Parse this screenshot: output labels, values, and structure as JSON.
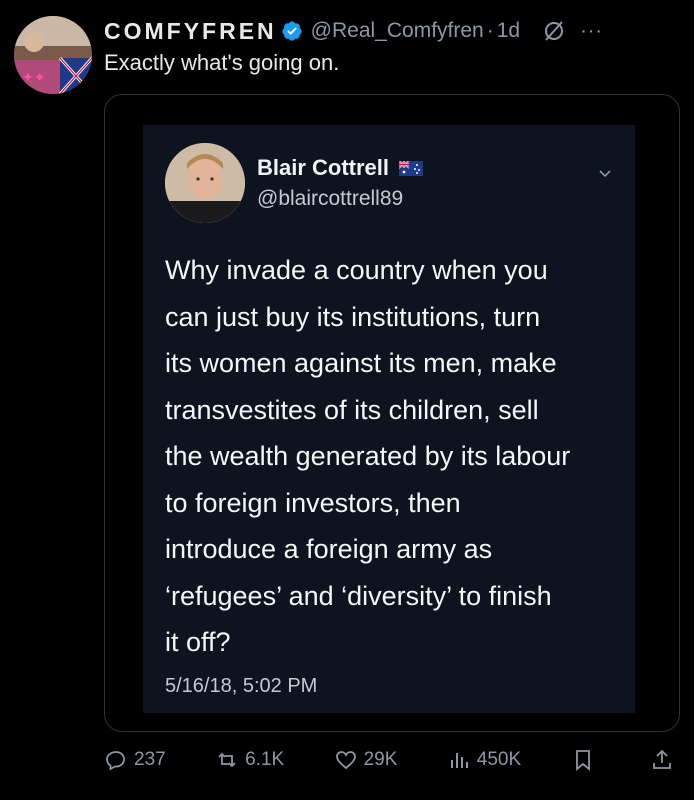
{
  "post": {
    "display_name": "COMFYFREN",
    "handle": "@Real_Comfyfren",
    "separator": "·",
    "time": "1d",
    "text": "Exactly what's going on.",
    "more_label": "···"
  },
  "quoted": {
    "display_name": "Blair Cottrell",
    "handle": "@blaircottrell89",
    "text": "Why invade a country when you\ncan just buy its institutions, turn\nits women against its men, make\ntransvestites of its children, sell\nthe wealth generated by its labour\nto foreign investors, then\nintroduce a foreign army as\n‘refugees’ and ‘diversity’ to finish\nit off?",
    "date": "5/16/18, 5:02 PM"
  },
  "actions": {
    "replies": "237",
    "reposts": "6.1K",
    "likes": "29K",
    "views": "450K"
  },
  "colors": {
    "background": "#000000",
    "muted": "#8b98a5",
    "verified": "#1d9bf0",
    "inner_bg": "#0d1420"
  },
  "icons": [
    "verified-icon",
    "grok-icon",
    "more-icon",
    "au-flag-icon",
    "chevron-down-icon",
    "reply-icon",
    "repost-icon",
    "like-icon",
    "views-icon",
    "bookmark-icon",
    "share-icon"
  ]
}
